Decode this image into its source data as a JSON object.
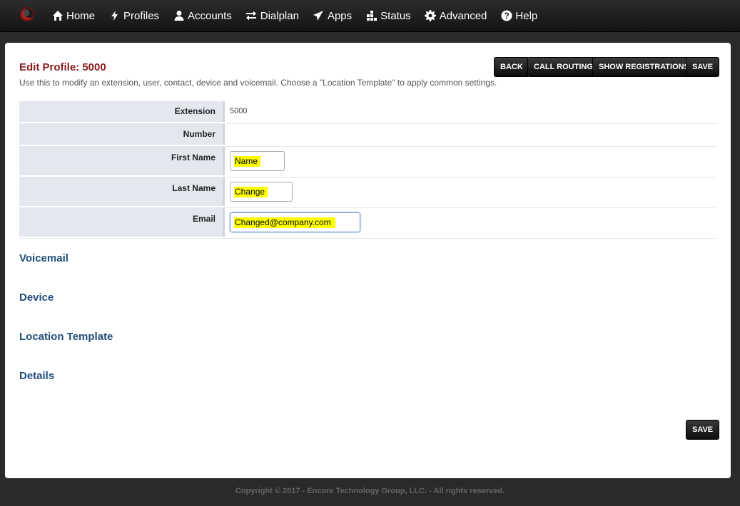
{
  "nav": {
    "items": [
      {
        "label": "Home",
        "icon": "home-icon"
      },
      {
        "label": "Profiles",
        "icon": "bolt-icon"
      },
      {
        "label": "Accounts",
        "icon": "user-icon"
      },
      {
        "label": "Dialplan",
        "icon": "arrows-icon"
      },
      {
        "label": "Apps",
        "icon": "send-icon"
      },
      {
        "label": "Status",
        "icon": "bars-icon"
      },
      {
        "label": "Advanced",
        "icon": "gear-icon"
      },
      {
        "label": "Help",
        "icon": "question-icon"
      }
    ]
  },
  "page": {
    "title": "Edit Profile: 5000",
    "description": "Use this to modify an extension, user, contact, device and voicemail. Choose a \"Location Template\" to apply common settings."
  },
  "toolbar": {
    "back_label": "BACK",
    "call_routing_label": "CALL ROUTING",
    "show_registrations_label": "SHOW REGISTRATIONS",
    "save_label": "SAVE"
  },
  "form": {
    "extension_label": "Extension",
    "extension_value": "5000",
    "number_label": "Number",
    "first_name_label": "First Name",
    "first_name_value": "Name",
    "last_name_label": "Last Name",
    "last_name_value": "Change",
    "email_label": "Email",
    "email_value": "Changed@company.com"
  },
  "sections": {
    "voicemail": "Voicemail",
    "device": "Device",
    "location_template": "Location Template",
    "details": "Details"
  },
  "footer": {
    "copyright": "Copyright © 2017 - Encore Technology Group, LLC. - All rights reserved."
  },
  "colors": {
    "title": "#8b1c1c",
    "section": "#1f4e7a",
    "highlight": "#ffff00"
  }
}
